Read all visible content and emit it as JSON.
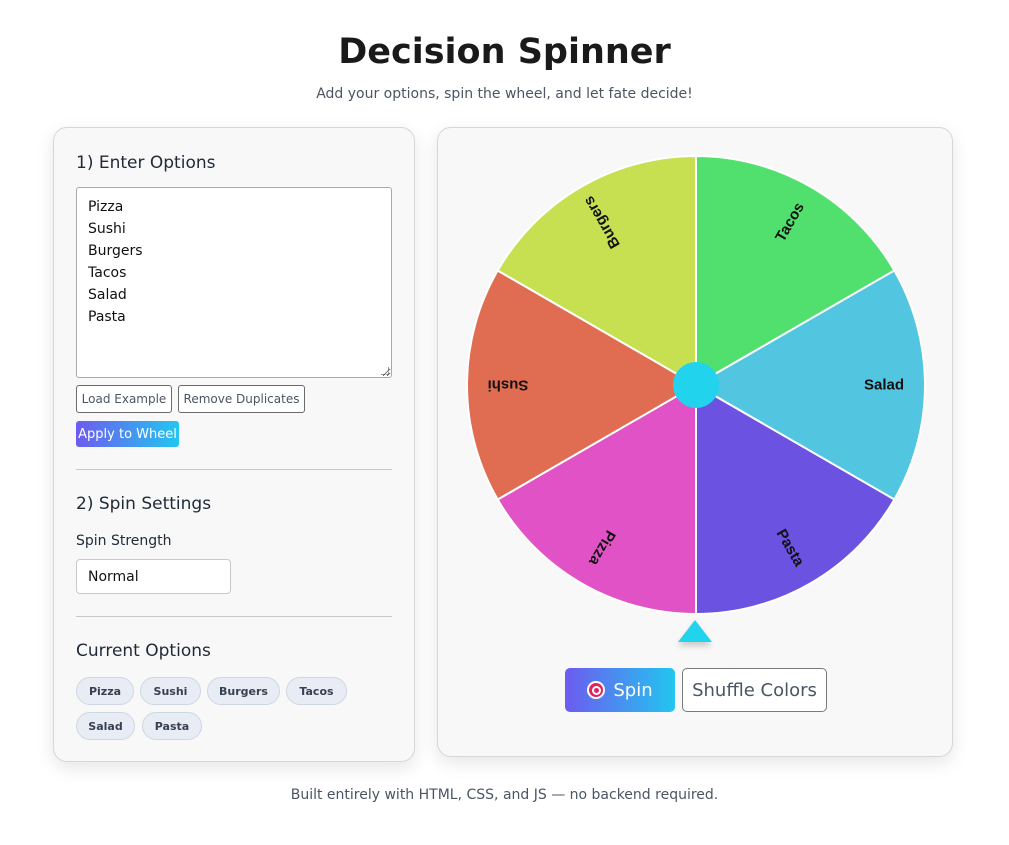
{
  "header": {
    "title": "Decision Spinner",
    "subtitle": "Add your options, spin the wheel, and let fate decide!"
  },
  "options_section": {
    "title": "1) Enter Options",
    "textarea_lines": [
      "Pizza",
      "Sushi",
      "Burgers",
      "Tacos",
      "Salad",
      "Pasta"
    ],
    "load_example_label": "Load Example",
    "remove_duplicates_label": "Remove Duplicates",
    "apply_label": "Apply to Wheel"
  },
  "spin_settings": {
    "title": "2) Spin Settings",
    "strength_label": "Spin Strength",
    "strength_value": "Normal"
  },
  "current_options": {
    "title": "Current Options",
    "chips": [
      "Pizza",
      "Sushi",
      "Burgers",
      "Tacos",
      "Salad",
      "Pasta"
    ]
  },
  "wheel": {
    "segments": [
      {
        "label": "Tacos",
        "color": "#51e06d"
      },
      {
        "label": "Salad",
        "color": "#52c6e0"
      },
      {
        "label": "Pasta",
        "color": "#6b52e0"
      },
      {
        "label": "Pizza",
        "color": "#e052c5"
      },
      {
        "label": "Sushi",
        "color": "#e06c52"
      },
      {
        "label": "Burgers",
        "color": "#c6e052"
      }
    ],
    "hub_color": "#22d3ee",
    "pointer_color": "#22d3ee"
  },
  "controls": {
    "spin_icon": "bullseye-icon",
    "spin_label": "Spin",
    "shuffle_label": "Shuffle Colors"
  },
  "footer": {
    "text": "Built entirely with HTML, CSS, and JS — no backend required."
  },
  "colors": {
    "accent_gradient_start": "#6d5bf0",
    "accent_gradient_end": "#22c6f0"
  }
}
